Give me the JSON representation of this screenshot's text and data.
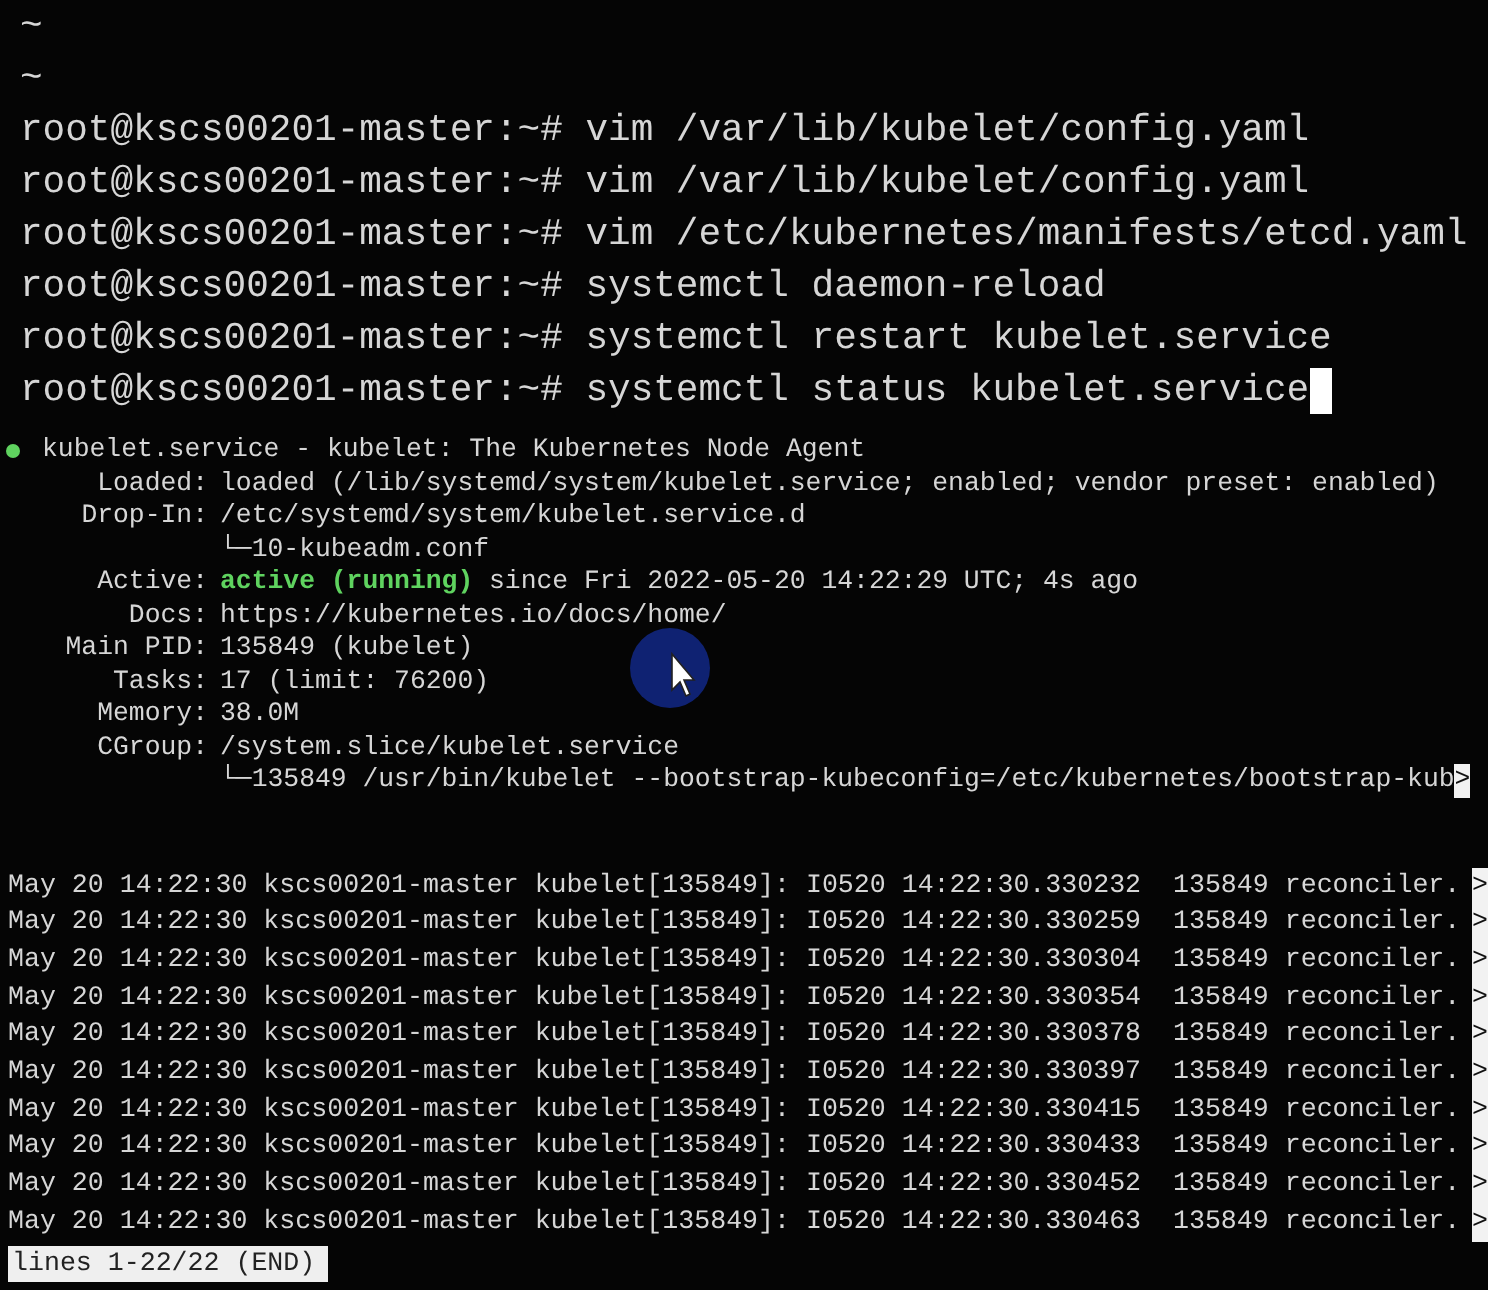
{
  "history": [
    "~",
    "~"
  ],
  "prompts": [
    {
      "text": "root@kscs00201-master:~# vim /var/lib/kubelet/config.yaml",
      "cursor": false
    },
    {
      "text": "root@kscs00201-master:~# vim /var/lib/kubelet/config.yaml",
      "cursor": false
    },
    {
      "text": "root@kscs00201-master:~# vim /etc/kubernetes/manifests/etcd.yaml",
      "cursor": false
    },
    {
      "text": "root@kscs00201-master:~# systemctl daemon-reload",
      "cursor": false
    },
    {
      "text": "root@kscs00201-master:~# systemctl restart kubelet.service",
      "cursor": false
    },
    {
      "text": "root@kscs00201-master:~# systemctl status kubelet.service",
      "cursor": true
    }
  ],
  "status": {
    "header": "kubelet.service - kubelet: The Kubernetes Node Agent",
    "fields": [
      {
        "label": "Loaded:",
        "value": "loaded (/lib/systemd/system/kubelet.service; enabled; vendor preset: enabled)"
      },
      {
        "label": "Drop-In:",
        "value": "/etc/systemd/system/kubelet.service.d",
        "sub_lines": [
          {
            "text": "└─10-kubeadm.conf"
          }
        ]
      },
      {
        "label": "Active:",
        "state": "active (running)",
        "value": "since Fri 2022-05-20 14:22:29 UTC; 4s ago"
      },
      {
        "label": "Docs:",
        "value": "https://kubernetes.io/docs/home/"
      },
      {
        "label": "Main PID:",
        "value": "135849 (kubelet)"
      },
      {
        "label": "Tasks:",
        "value": "17 (limit: 76200)"
      },
      {
        "label": "Memory:",
        "value": "38.0M"
      },
      {
        "label": "CGroup:",
        "value": "/system.slice/kubelet.service",
        "sub_lines": [
          {
            "text": "└─135849 /usr/bin/kubelet --bootstrap-kubeconfig=/etc/kubernetes/bootstrap-kub",
            "more": ">"
          }
        ]
      }
    ]
  },
  "log": [
    {
      "text": "May 20 14:22:30 kscs00201-master kubelet[135849]: I0520 14:22:30.330232  135849 reconciler.",
      "more": ">"
    },
    {
      "text": "May 20 14:22:30 kscs00201-master kubelet[135849]: I0520 14:22:30.330259  135849 reconciler.",
      "more": ">"
    },
    {
      "text": "May 20 14:22:30 kscs00201-master kubelet[135849]: I0520 14:22:30.330304  135849 reconciler.",
      "more": ">"
    },
    {
      "text": "May 20 14:22:30 kscs00201-master kubelet[135849]: I0520 14:22:30.330354  135849 reconciler.",
      "more": ">"
    },
    {
      "text": "May 20 14:22:30 kscs00201-master kubelet[135849]: I0520 14:22:30.330378  135849 reconciler.",
      "more": ">"
    },
    {
      "text": "May 20 14:22:30 kscs00201-master kubelet[135849]: I0520 14:22:30.330397  135849 reconciler.",
      "more": ">"
    },
    {
      "text": "May 20 14:22:30 kscs00201-master kubelet[135849]: I0520 14:22:30.330415  135849 reconciler.",
      "more": ">"
    },
    {
      "text": "May 20 14:22:30 kscs00201-master kubelet[135849]: I0520 14:22:30.330433  135849 reconciler.",
      "more": ">"
    },
    {
      "text": "May 20 14:22:30 kscs00201-master kubelet[135849]: I0520 14:22:30.330452  135849 reconciler.",
      "more": ">"
    },
    {
      "text": "May 20 14:22:30 kscs00201-master kubelet[135849]: I0520 14:22:30.330463  135849 reconciler.",
      "more": ">"
    }
  ],
  "pager_status": "lines 1-22/22 (END)"
}
